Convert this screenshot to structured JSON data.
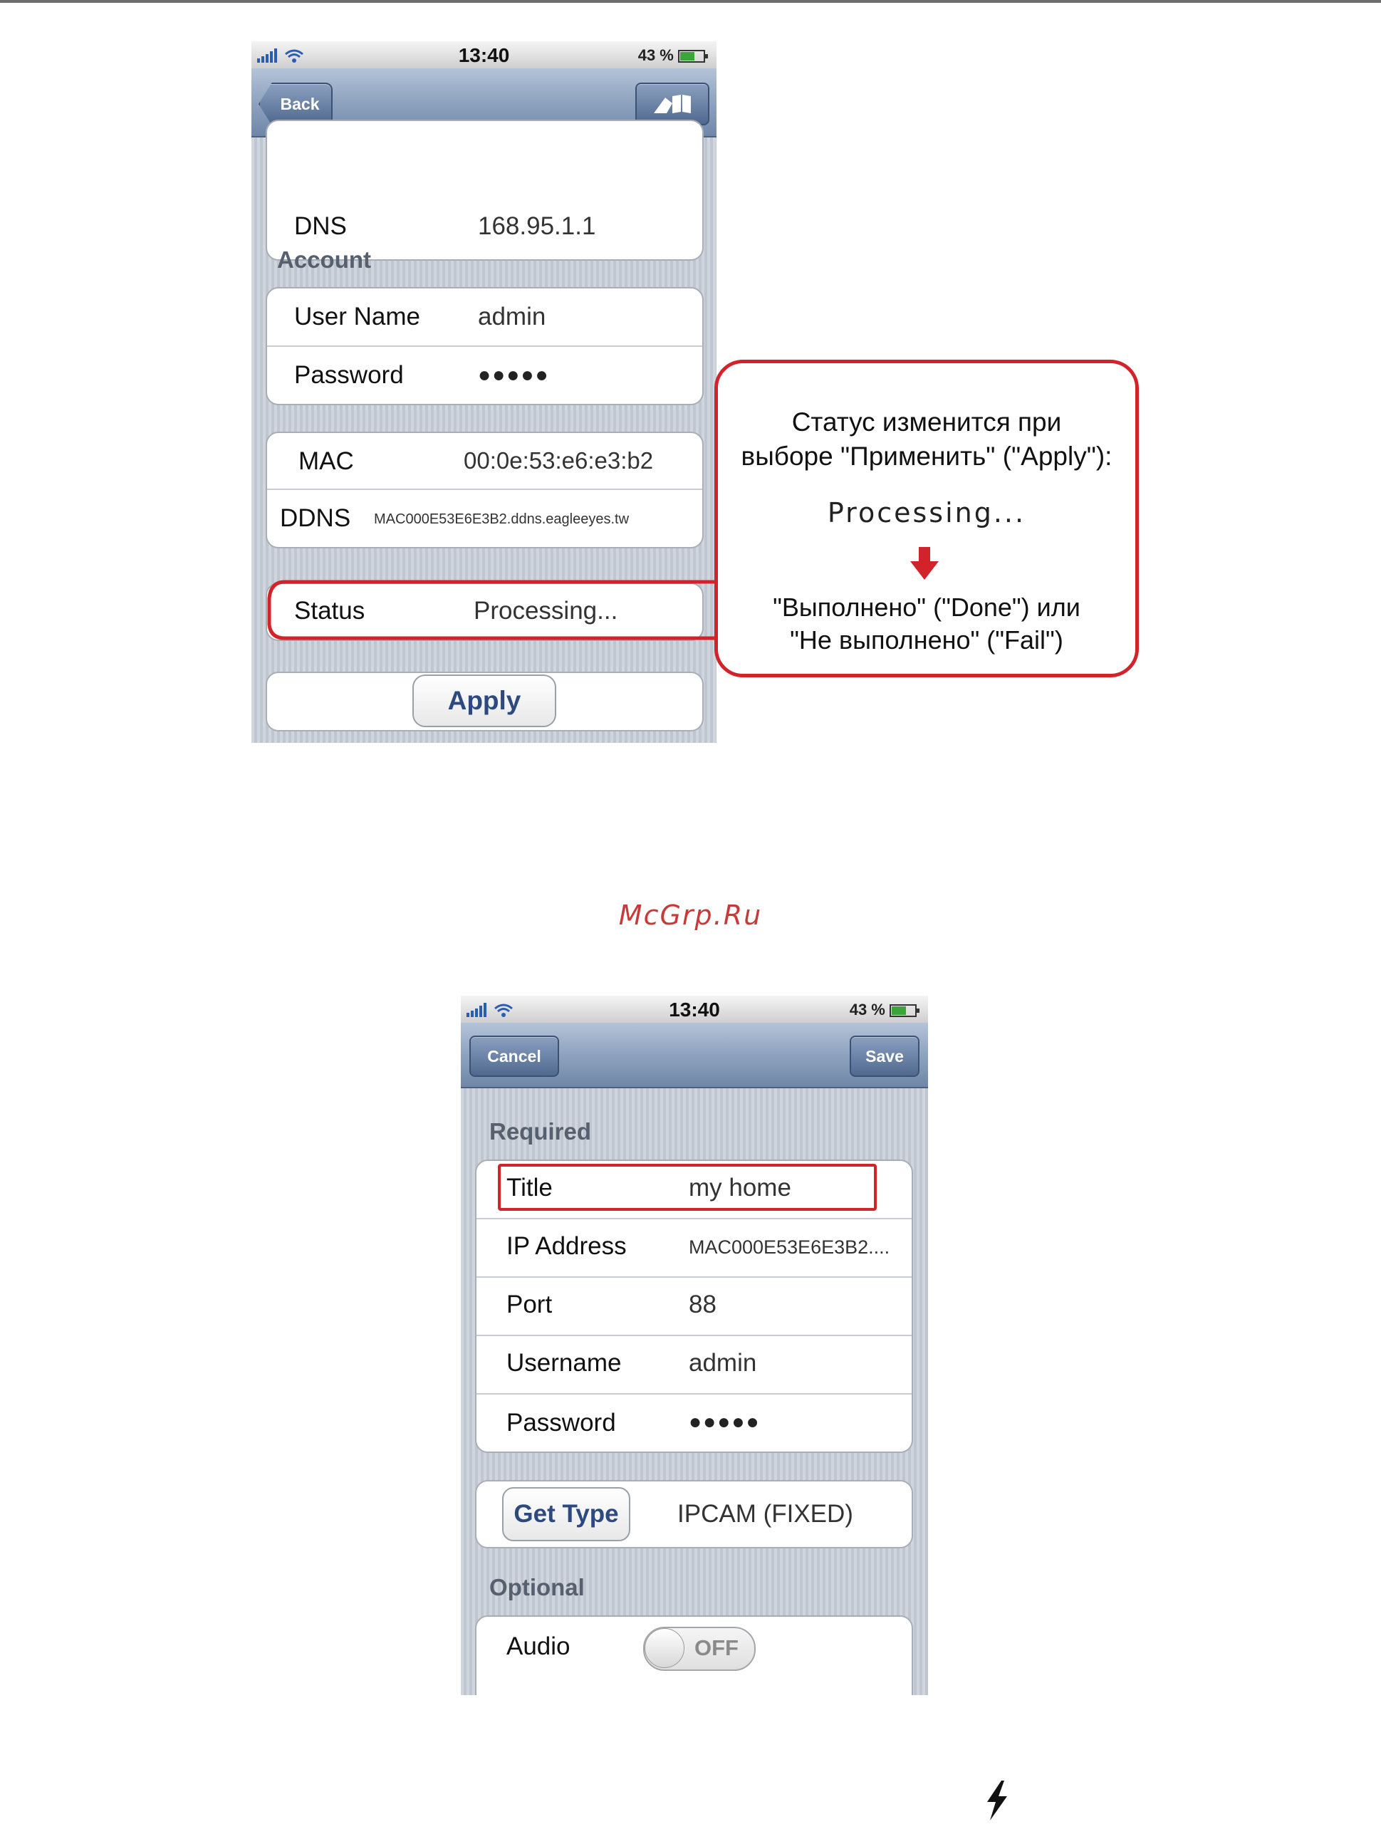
{
  "phone1": {
    "status_time": "13:40",
    "battery": "43 %",
    "back_label": "Back",
    "dns_label": "DNS",
    "dns_value": "168.95.1.1",
    "account_header": "Account",
    "username_label": "User Name",
    "username_value": "admin",
    "password_label": "Password",
    "password_value": "●●●●●",
    "mac_label": "MAC",
    "mac_value": "00:0e:53:e6:e3:b2",
    "ddns_label": "DDNS",
    "ddns_value": "MAC000E53E6E3B2.ddns.eagleeyes.tw",
    "status_label": "Status",
    "status_value": "Processing...",
    "apply_label": "Apply"
  },
  "callout": {
    "line1": "Статус изменится при",
    "line2": "выборе \"Применить\" (\"Apply\"):",
    "processing": "Processing...",
    "line3": "\"Выполнено\" (\"Done\") или",
    "line4": "\"Не выполнено\" (\"Fail\")",
    "accent_color": "#d3232a"
  },
  "watermark": "McGrp.Ru",
  "phone2": {
    "status_time": "13:40",
    "battery": "43 %",
    "cancel_label": "Cancel",
    "save_label": "Save",
    "required_header": "Required",
    "title_label": "Title",
    "title_value": "my home",
    "ip_label": "IP Address",
    "ip_value": "MAC000E53E6E3B2....",
    "port_label": "Port",
    "port_value": "88",
    "username_label": "Username",
    "username_value": "admin",
    "password_label": "Password",
    "password_value": "●●●●●",
    "get_type_label": "Get Type",
    "type_value": "IPCAM (FIXED)",
    "optional_header": "Optional",
    "audio_label": "Audio",
    "audio_toggle": "OFF"
  }
}
